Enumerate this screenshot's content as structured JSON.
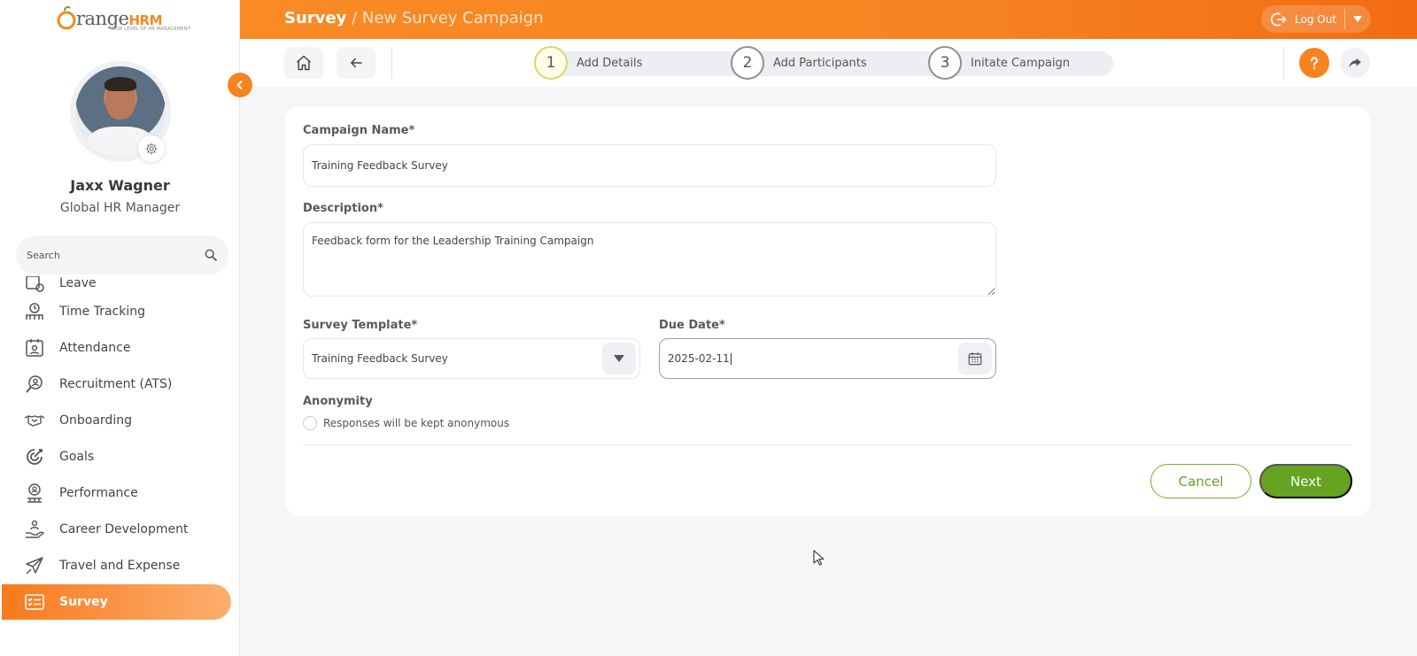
{
  "app": {
    "brand": {
      "prefix": "O",
      "word": "range",
      "suffix": "HRM",
      "tagline": "NEW LEVEL OF HR MANAGEMENT"
    },
    "title": "Survey",
    "breadcrumb_sep": " / ",
    "subtitle": "New Survey Campaign",
    "logout_label": "Log Out",
    "accent_color": "#f7831e",
    "primary_green": "#66a323"
  },
  "user": {
    "name": "Jaxx Wagner",
    "role": "Global HR Manager"
  },
  "sidebar": {
    "search_placeholder": "Search",
    "items": [
      {
        "label": "Leave",
        "icon": "leave-icon"
      },
      {
        "label": "Time Tracking",
        "icon": "time-tracking-icon"
      },
      {
        "label": "Attendance",
        "icon": "attendance-icon"
      },
      {
        "label": "Recruitment (ATS)",
        "icon": "recruitment-icon"
      },
      {
        "label": "Onboarding",
        "icon": "handshake-icon"
      },
      {
        "label": "Goals",
        "icon": "target-icon"
      },
      {
        "label": "Performance",
        "icon": "performance-icon"
      },
      {
        "label": "Career Development",
        "icon": "career-icon"
      },
      {
        "label": "Travel and Expense",
        "icon": "plane-icon"
      },
      {
        "label": "Survey",
        "icon": "survey-icon",
        "active": true
      }
    ]
  },
  "stepper": {
    "steps": [
      {
        "num": "1",
        "label": "Add Details",
        "current": true
      },
      {
        "num": "2",
        "label": "Add Participants"
      },
      {
        "num": "3",
        "label": "Initate Campaign"
      }
    ]
  },
  "form": {
    "campaign_name": {
      "label": "Campaign Name*",
      "value": "Training Feedback Survey"
    },
    "description": {
      "label": "Description*",
      "value": "Feedback form for the Leadership Training Campaign"
    },
    "survey_template": {
      "label": "Survey Template*",
      "value": "Training Feedback Survey"
    },
    "due_date": {
      "label": "Due Date*",
      "value": "2025-02-11"
    },
    "anonymity": {
      "label": "Anonymity",
      "checkbox_label": "Responses will be kept anonymous",
      "checked": false
    },
    "cancel_label": "Cancel",
    "next_label": "Next"
  }
}
